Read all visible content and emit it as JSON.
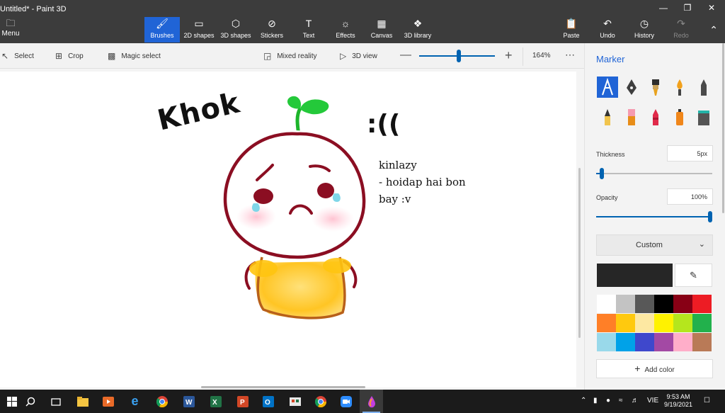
{
  "window": {
    "title": "Untitled* - Paint 3D",
    "minimize_icon": "minimize-icon",
    "maximize_icon": "restore-icon",
    "close_icon": "close-icon"
  },
  "ribbon": {
    "menu_label": "Menu",
    "tools": [
      {
        "label": "Brushes",
        "icon": "brush-icon",
        "active": true
      },
      {
        "label": "2D shapes",
        "icon": "shapes-2d-icon"
      },
      {
        "label": "3D shapes",
        "icon": "cube-icon"
      },
      {
        "label": "Stickers",
        "icon": "sticker-icon"
      },
      {
        "label": "Text",
        "icon": "text-icon"
      },
      {
        "label": "Effects",
        "icon": "sun-icon"
      },
      {
        "label": "Canvas",
        "icon": "canvas-icon"
      },
      {
        "label": "3D library",
        "icon": "library-icon"
      }
    ],
    "right_tools": [
      {
        "label": "Paste",
        "icon": "paste-icon"
      },
      {
        "label": "Undo",
        "icon": "undo-icon"
      },
      {
        "label": "History",
        "icon": "history-icon"
      },
      {
        "label": "Redo",
        "icon": "redo-icon",
        "disabled": true
      }
    ]
  },
  "toolbar": {
    "select": "Select",
    "crop": "Crop",
    "magic_select": "Magic select",
    "mixed_reality": "Mixed reality",
    "view_3d": "3D view",
    "zoom_minus": "—",
    "zoom_plus": "+",
    "zoom_percent": "164%",
    "zoom_level": 0.52,
    "more": "⋯"
  },
  "drawing": {
    "khok": "Khok",
    "sad_face": ":((",
    "note_lines": [
      "kinlazy",
      "- hoidap hai bon",
      "bay :v"
    ]
  },
  "panel": {
    "title": "Marker",
    "brushes": [
      "marker",
      "calligraphy-pen",
      "oil-brush",
      "watercolor",
      "pixel-pen",
      "pencil",
      "eraser",
      "crayon",
      "spraycan",
      "fill"
    ],
    "selected_brush": "marker",
    "thickness_label": "Thickness",
    "thickness_value": "5px",
    "thickness_level": 0.05,
    "opacity_label": "Opacity",
    "opacity_value": "100%",
    "opacity_level": 1.0,
    "finish": "Custom",
    "current_color": "#262626",
    "eyedropper_icon": "eyedropper-icon",
    "palette": [
      "#ffffff",
      "#c3c3c3",
      "#585858",
      "#000000",
      "#880015",
      "#ed1c24",
      "#ff7f27",
      "#ffc90e",
      "#fde8a2",
      "#fff200",
      "#b5e61d",
      "#22b14c",
      "#99d9ea",
      "#00a2e8",
      "#3f48cc",
      "#a349a4",
      "#ffaec9",
      "#b97a57"
    ],
    "add_color": "Add color"
  },
  "taskbar": {
    "apps": [
      "start",
      "search",
      "task-view",
      "file-explorer",
      "media",
      "edge",
      "chrome",
      "word",
      "excel",
      "powerpoint",
      "outlook",
      "photos",
      "chrome-2",
      "zoom",
      "paint3d"
    ],
    "language": "VIE",
    "time": "9:53 AM",
    "date": "9/19/2021"
  }
}
